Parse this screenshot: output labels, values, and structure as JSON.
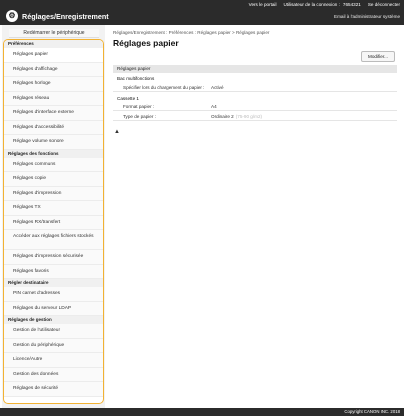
{
  "header": {
    "portal_link": "Vers le portail",
    "user_label": "Utilisateur de la connexion :",
    "user_id": "7654321",
    "logout_link": "Se déconnecter",
    "app_title": "Réglages/Enregistrement",
    "admin_mail_link": "Email à l'administrateur système"
  },
  "sidebar": {
    "restart_button": "Redémarrer le périphérique",
    "sections": [
      {
        "title": "Préférences",
        "items": [
          "Réglages papier",
          "Réglages d'affichage",
          "Réglages horloge",
          "Réglages réseau",
          "Réglages d'interface externe",
          "Réglages d'accessibilité",
          "Réglage volume sonore"
        ]
      },
      {
        "title": "Réglages des fonctions",
        "items": [
          "Réglages communs",
          "Réglages copie",
          "Réglages d'impression",
          "Réglages TX",
          "Réglages RX/transfert",
          "Accéder aux réglages fichiers stockés",
          "Réglages d'impression sécurisée",
          "Réglages favoris"
        ]
      },
      {
        "title": "Régler destinataire",
        "items": [
          "PIN carnet d'adresses",
          "Réglages du serveur LDAP"
        ]
      },
      {
        "title": "Réglages de gestion",
        "items": [
          "Gestion de l'utilisateur",
          "Gestion du périphérique",
          "Licence/Autre",
          "Gestion des données",
          "Réglages de sécurité"
        ]
      }
    ]
  },
  "main": {
    "breadcrumb": "Réglages/Enregistrement : Préférences : Réglages papier > Réglages papier",
    "title": "Réglages papier",
    "modify_button": "Modifier...",
    "section_header": "Réglages papier",
    "bypass": {
      "title": "Bac multifonctions",
      "row_label": "Spécifier lors du chargement du papier :",
      "row_value": "Activé"
    },
    "cassette": {
      "title": "Cassette 1",
      "rows": [
        {
          "label": "Format papier :",
          "value": "A4",
          "note": ""
        },
        {
          "label": "Type de papier :",
          "value": "Ordinaire 2",
          "note": "(75-90 g/m2)"
        }
      ]
    },
    "back_to_top": "▲"
  },
  "footer": {
    "copyright": "Copyright CANON INC. 2018"
  }
}
